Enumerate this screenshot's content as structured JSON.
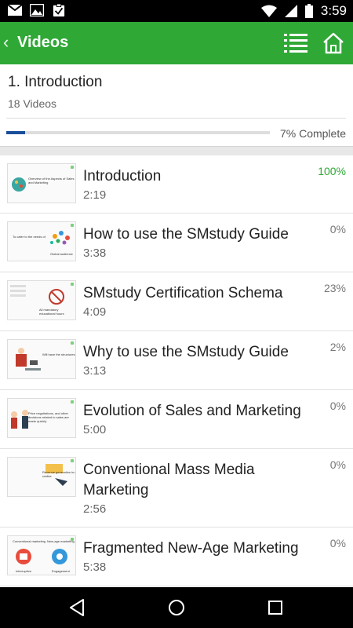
{
  "status_bar": {
    "time": "3:59",
    "left_icons": [
      "gmail-icon",
      "image-icon",
      "clipboard-check-icon"
    ],
    "right_icons": [
      "wifi-icon",
      "signal-icon",
      "battery-icon"
    ]
  },
  "app_bar": {
    "back_glyph": "‹",
    "title": "Videos",
    "color": "#2fa836"
  },
  "section": {
    "title": "1. Introduction",
    "count_label": "18 Videos",
    "progress_percent": 7,
    "progress_label": "7% Complete"
  },
  "videos": [
    {
      "title": "Introduction",
      "duration": "2:19",
      "percent": "100%",
      "thumb_caption": "Overview of the Aspects of Sales and Marketing"
    },
    {
      "title": "How to use the SMstudy Guide",
      "duration": "3:38",
      "percent": "0%",
      "thumb_caption": "To cater to the needs of",
      "thumb_caption_2": "Global audience"
    },
    {
      "title": "SMstudy Certification Schema",
      "duration": "4:09",
      "percent": "23%",
      "thumb_caption": "All mandatory educational hours"
    },
    {
      "title": "Why to use the SMstudy Guide",
      "duration": "3:13",
      "percent": "2%",
      "thumb_caption": "Will have the structures"
    },
    {
      "title": "Evolution of Sales and Marketing",
      "duration": "5:00",
      "percent": "0%",
      "thumb_caption": "Price negotiations, and other decisions related to sales are made quickly"
    },
    {
      "title": "Conventional Mass Media Marketing",
      "duration": "2:56",
      "percent": "0%",
      "thumb_caption": "Revenue generation is easy to realize"
    },
    {
      "title": "Fragmented New-Age Marketing",
      "duration": "5:38",
      "percent": "0%",
      "thumb_caption": "Conventional marketing",
      "thumb_caption_2": "New-age marketing",
      "thumb_caption_3": "Interruptive",
      "thumb_caption_4": "Engagement"
    }
  ],
  "nav_bar": {
    "buttons": [
      "back-icon",
      "home-circle-icon",
      "recents-square-icon"
    ]
  }
}
